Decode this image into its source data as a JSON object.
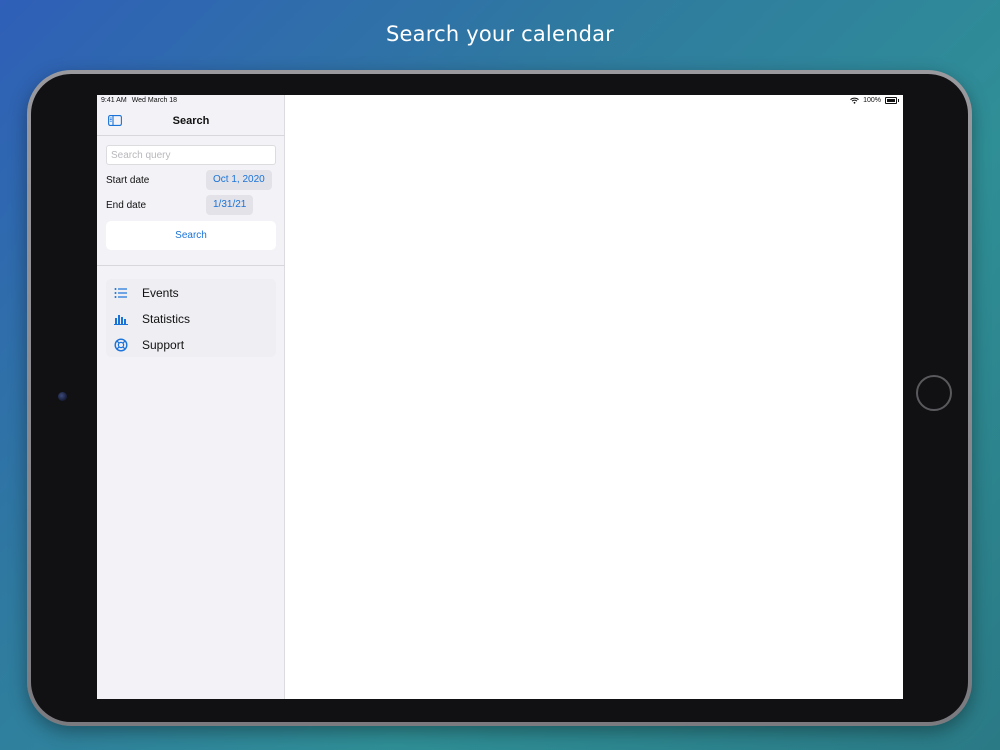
{
  "headline": "Search your calendar",
  "status_bar": {
    "time": "9:41 AM",
    "date": "Wed March 18",
    "battery": "100%",
    "icons": [
      "wifi-icon",
      "battery-icon"
    ]
  },
  "sidebar": {
    "title": "Search",
    "toggle_icon": "sidebar-toggle-icon",
    "search": {
      "placeholder": "Search query",
      "value": ""
    },
    "start_date": {
      "label": "Start date",
      "value": "Oct 1, 2020"
    },
    "end_date": {
      "label": "End date",
      "value": "1/31/21"
    },
    "search_button": "Search",
    "nav_items": [
      {
        "label": "Events",
        "icon": "list-icon"
      },
      {
        "label": "Statistics",
        "icon": "bar-chart-icon"
      },
      {
        "label": "Support",
        "icon": "lifebuoy-icon"
      }
    ]
  },
  "colors": {
    "accent": "#1a73d9",
    "sidebar_bg": "#f2f2f7",
    "device_bezel": "#111113"
  }
}
